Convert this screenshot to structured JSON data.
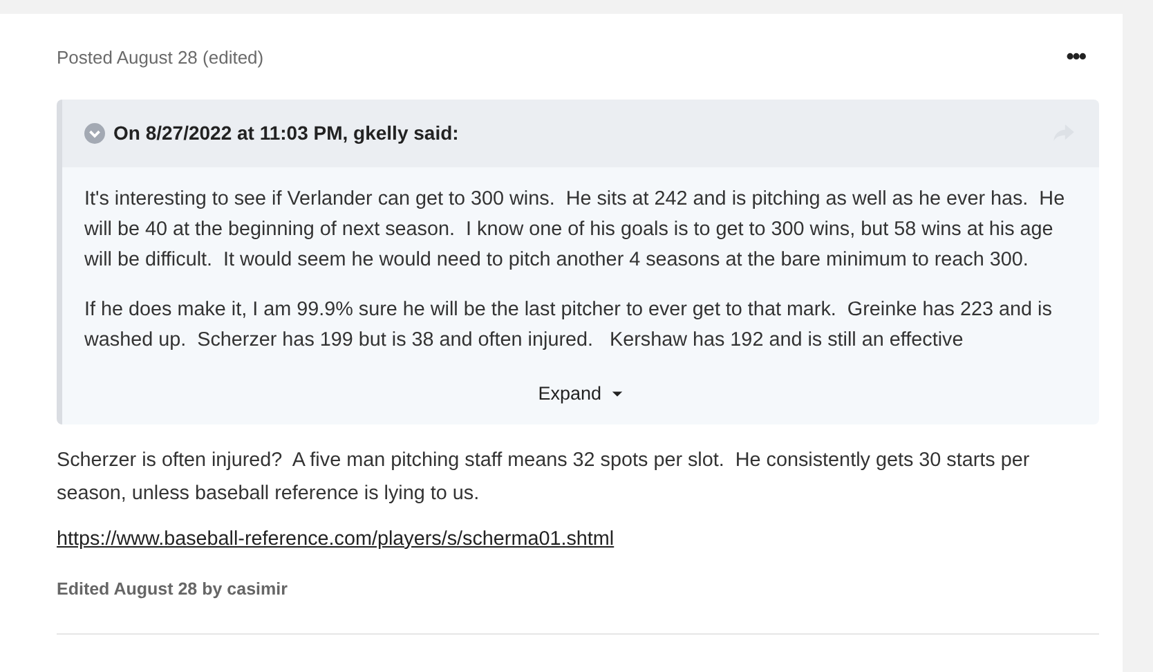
{
  "post": {
    "meta": "Posted August 28 (edited)",
    "menu": "•••",
    "quote": {
      "expanded": false,
      "citation": "On 8/27/2022 at 11:03 PM, gkelly said:",
      "paragraphs": [
        "It's interesting to see if Verlander can get to 300 wins.  He sits at 242 and is pitching as well as he ever has.  He will be 40 at the beginning of next season.  I know one of his goals is to get to 300 wins, but 58 wins at his age will be difficult.  It would seem he would need to pitch another 4 seasons at the bare minimum to reach 300.",
        "If he does make it, I am 99.9% sure he will be the last pitcher to ever get to that mark.  Greinke has 223 and is washed up.  Scherzer has 199 but is 38 and often injured.   Kershaw has 192 and is still an effective"
      ],
      "expand_label": "Expand"
    },
    "body": "Scherzer is often injured?  A five man pitching staff means 32 spots per slot.  He consistently gets 30 starts per season, unless baseball reference is lying to us.",
    "link": "https://www.baseball-reference.com/players/s/scherma01.shtml",
    "edited": "Edited August 28 by casimir"
  }
}
